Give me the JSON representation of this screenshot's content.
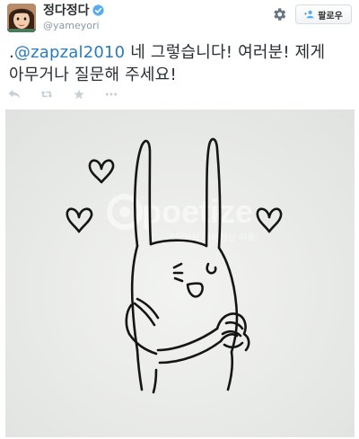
{
  "header": {
    "display_name": "정다정다",
    "username": "@yameyori",
    "follow_label": "팔로우"
  },
  "tweet": {
    "text_prefix": ".",
    "mention": "@zapzal2010",
    "text_line1_rest": " 네 그렇습니다! 여러분! 제게",
    "text_line2": "아무거나 질문해 주세요!"
  },
  "actions": [
    "reply-icon",
    "retweet-icon",
    "favorite-icon",
    "more-icon"
  ],
  "watermark": {
    "brand": "poetize",
    "subtitle": "국민일보 김태형상 이용"
  },
  "colors": {
    "link": "#2b7bb9",
    "verified": "#55acee",
    "muted": "#8899a6",
    "paper": "#edeeec"
  }
}
